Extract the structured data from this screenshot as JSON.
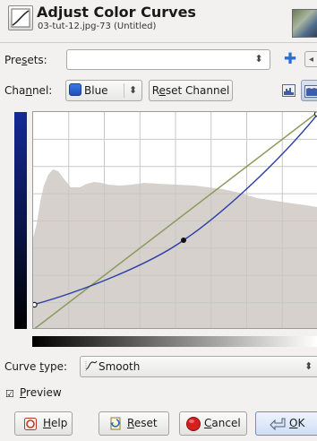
{
  "header": {
    "title": "Adjust Color Curves",
    "subtitle": "03-tut-12.jpg-73 (Untitled)"
  },
  "presets": {
    "label_pre": "Pre",
    "label_mnemonic": "s",
    "label_post": "ets:",
    "value": ""
  },
  "channel": {
    "label_pre": "Cha",
    "label_mnemonic": "n",
    "label_post": "nel:",
    "value": "Blue",
    "reset_pre": "R",
    "reset_mnemonic": "e",
    "reset_post": "set Channel"
  },
  "curve_type": {
    "label_pre": "Curve ",
    "label_mnemonic": "t",
    "label_post": "ype:",
    "value": "Smooth"
  },
  "preview": {
    "checked": true,
    "mnemonic": "P",
    "label_post": "review"
  },
  "buttons": {
    "help_mnemonic": "H",
    "help_post": "elp",
    "reset_mnemonic": "R",
    "reset_post": "eset",
    "cancel_mnemonic": "C",
    "cancel_post": "ancel",
    "ok_pre": "",
    "ok_mnemonic": "O",
    "ok_post": "K"
  },
  "icons": {
    "header": "curves-tool-icon",
    "thumbnail": "image-thumbnail",
    "add_preset": "plus-icon",
    "preset_menu": "chevron-left-icon",
    "linear": "linear-histogram-icon",
    "log": "log-histogram-icon",
    "smooth": "smooth-curve-icon",
    "help": "help-icon",
    "reset": "reset-icon",
    "cancel": "cancel-icon",
    "ok": "ok-icon"
  },
  "colors": {
    "curve_blue": "#2b3fa8",
    "identity_line": "#8a9a5b",
    "histogram": "#d6d1cc",
    "grid": "#c8c8c8",
    "cancel_red": "#d41f1f"
  }
}
